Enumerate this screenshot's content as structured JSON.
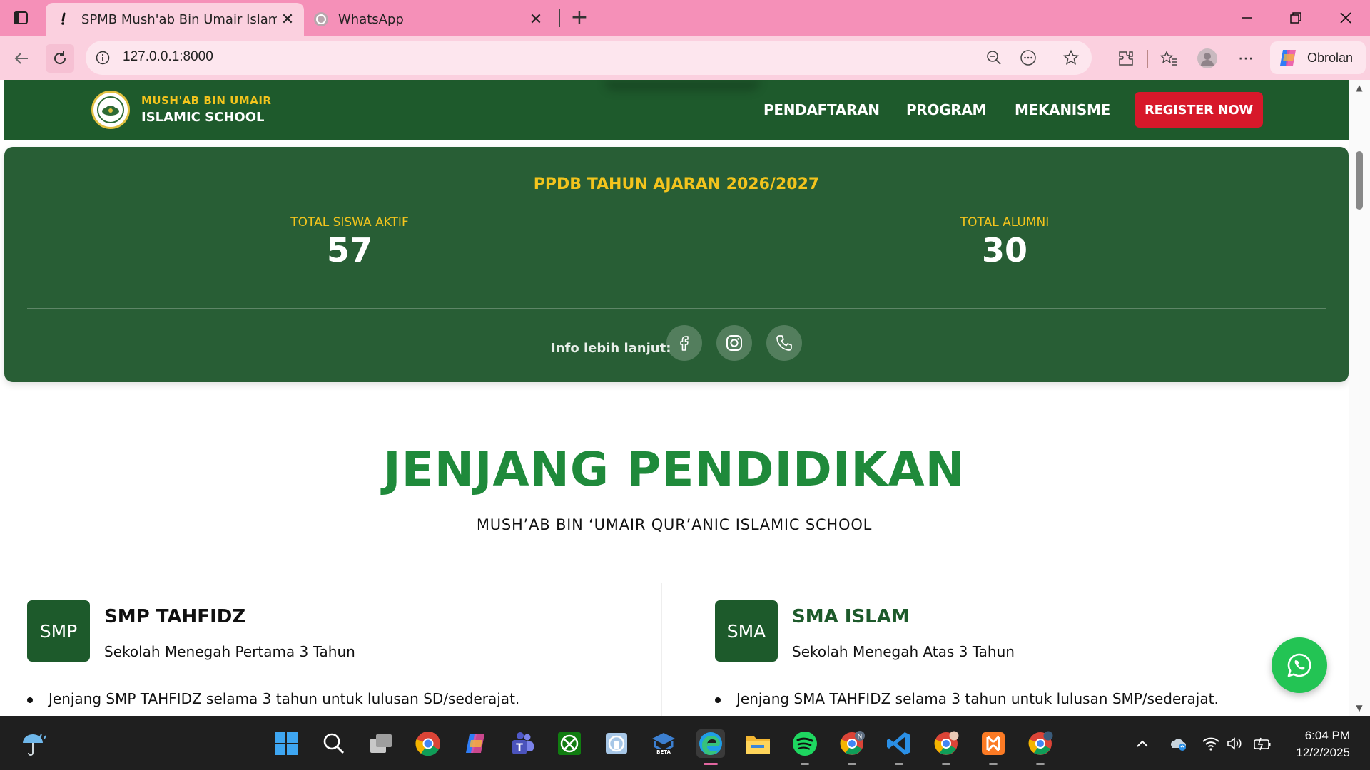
{
  "browser": {
    "tabs": [
      {
        "title": "SPMB Mush'ab Bin Umair Islamic School",
        "active": true
      },
      {
        "title": "WhatsApp",
        "active": false
      }
    ],
    "url": "127.0.0.1:8000",
    "copilot_label": "Obrolan"
  },
  "navbar": {
    "brand_top": "MUSH'AB BIN UMAIR",
    "brand_bottom": "ISLAMIC SCHOOL",
    "links": [
      "PENDAFTARAN",
      "PROGRAM",
      "MEKANISME"
    ],
    "cta": "REGISTER NOW"
  },
  "stats": {
    "title": "PPDB TAHUN AJARAN 2026/2027",
    "items": [
      {
        "label": "TOTAL SISWA AKTIF",
        "value": "57"
      },
      {
        "label": "TOTAL ALUMNI",
        "value": "30"
      }
    ],
    "info_label": "Info lebih lanjut:",
    "socials": [
      "facebook-icon",
      "instagram-icon",
      "phone-icon"
    ]
  },
  "jenjang": {
    "title": "JENJANG PENDIDIKAN",
    "subtitle": "MUSH’AB BIN ‘UMAIR QUR’ANIC ISLAMIC SCHOOL",
    "levels": [
      {
        "badge": "SMP",
        "name": "SMP TAHFIDZ",
        "desc": "Sekolah Menegah Pertama 3 Tahun",
        "bullet": "Jenjang SMP TAHFIDZ selama 3 tahun untuk lulusan SD/sederajat.",
        "name_color": "#111111"
      },
      {
        "badge": "SMA",
        "name": "SMA ISLAM",
        "desc": "Sekolah Menegah Atas 3 Tahun",
        "bullet": "Jenjang SMA TAHFIDZ selama 3 tahun untuk lulusan SMP/sederajat.",
        "name_color": "#1d5a2b"
      }
    ]
  },
  "taskbar": {
    "time": "6:04 PM",
    "date": "12/2/2025"
  },
  "colors": {
    "primary_green": "#1e5a2c",
    "card_green": "#285e35",
    "accent_yellow": "#f3c41d",
    "cta_red": "#d7182a",
    "heading_green": "#1f8a3b",
    "whatsapp_green": "#23c454"
  }
}
